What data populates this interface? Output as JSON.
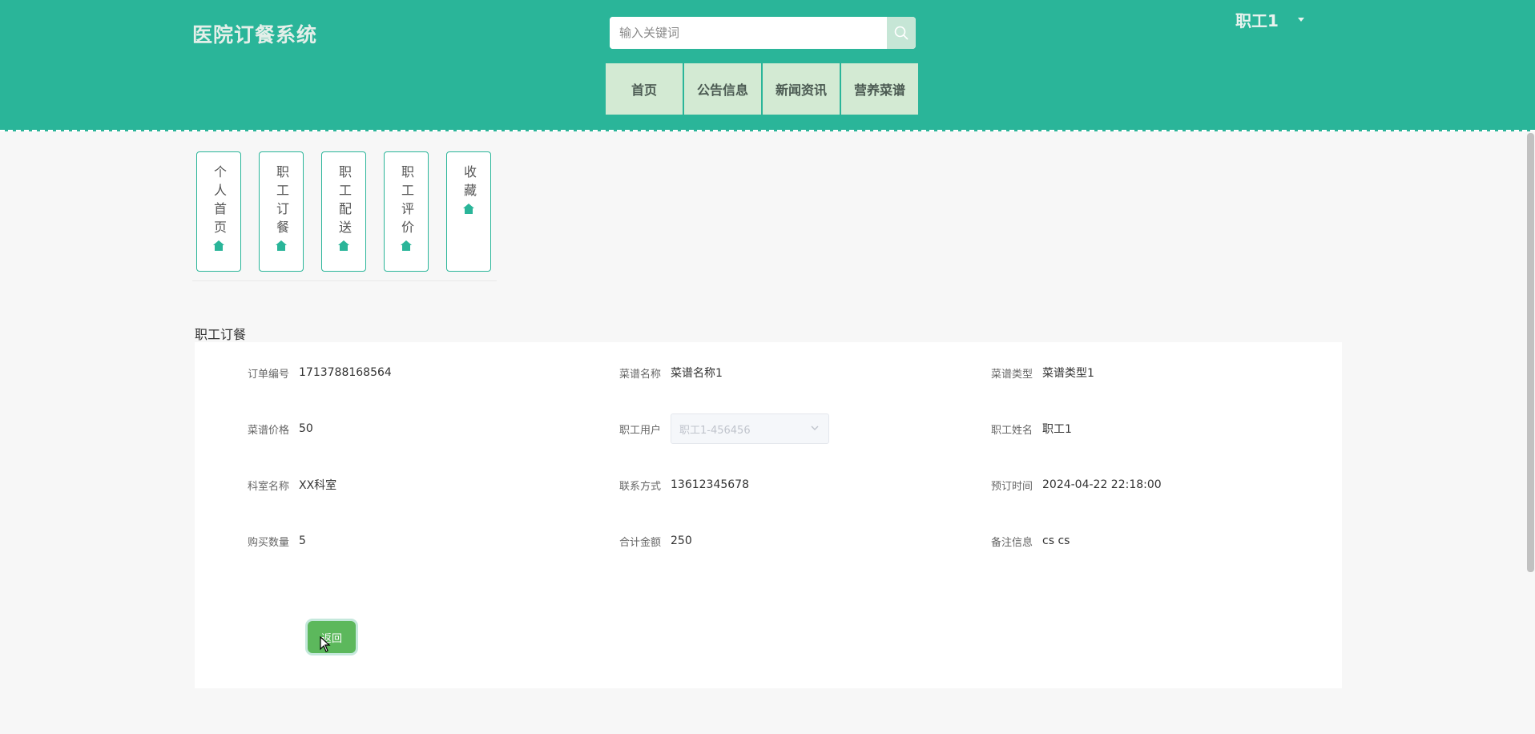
{
  "header": {
    "logo": "医院订餐系统",
    "search_placeholder": "输入关键词",
    "user_name": "职工1",
    "nav": [
      "首页",
      "公告信息",
      "新闻资讯",
      "营养菜谱"
    ]
  },
  "sidebar": {
    "items": [
      {
        "label": "个人首页"
      },
      {
        "label": "职工订餐"
      },
      {
        "label": "职工配送"
      },
      {
        "label": "职工评价"
      },
      {
        "label": "收藏"
      }
    ]
  },
  "section_title": "职工订餐",
  "fields": {
    "order_no": {
      "label": "订单编号",
      "value": "1713788168564"
    },
    "dish_name": {
      "label": "菜谱名称",
      "value": "菜谱名称1"
    },
    "dish_type": {
      "label": "菜谱类型",
      "value": "菜谱类型1"
    },
    "dish_price": {
      "label": "菜谱价格",
      "value": "50"
    },
    "staff_user": {
      "label": "职工用户",
      "value": "职工1-456456"
    },
    "staff_name": {
      "label": "职工姓名",
      "value": "职工1"
    },
    "dept_name": {
      "label": "科室名称",
      "value": "XX科室"
    },
    "contact": {
      "label": "联系方式",
      "value": "13612345678"
    },
    "order_time": {
      "label": "预订时间",
      "value": "2024-04-22 22:18:00"
    },
    "quantity": {
      "label": "购买数量",
      "value": "5"
    },
    "total": {
      "label": "合计金额",
      "value": "250"
    },
    "remark": {
      "label": "备注信息",
      "value": "cs cs"
    }
  },
  "back_label": "返回",
  "colors": {
    "primary": "#2ab599",
    "nav_bg": "#d3ead3",
    "back_button": "#5cb85c"
  }
}
